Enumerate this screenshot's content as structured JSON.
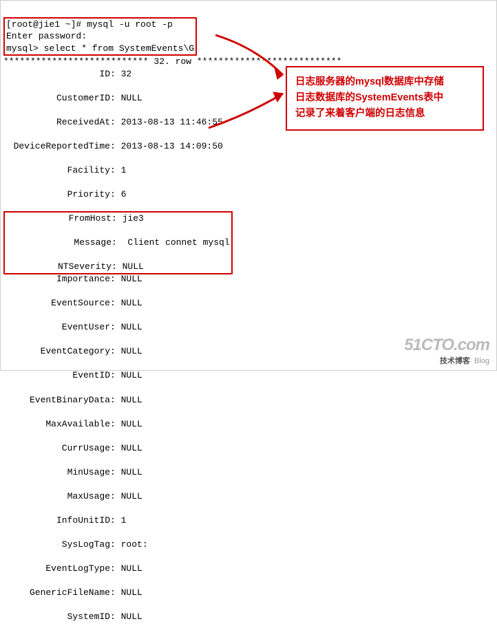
{
  "command_block": {
    "prompt": "[root@jie1 ~]# ",
    "cmd1": "mysql -u root -p",
    "pw_prompt": "Enter password:",
    "mysql_prompt": "mysql> ",
    "cmd2": "select * from SystemEvents\\G"
  },
  "separator": "*************************** 32. row ***************************",
  "rows": [
    {
      "key": "ID",
      "val": "32"
    },
    {
      "key": "CustomerID",
      "val": "NULL"
    },
    {
      "key": "ReceivedAt",
      "val": "2013-08-13 11:46:55"
    },
    {
      "key": "DeviceReportedTime",
      "val": "2013-08-13 14:09:50"
    },
    {
      "key": "Facility",
      "val": "1"
    },
    {
      "key": "Priority",
      "val": "6"
    },
    {
      "key": "FromHost",
      "val": "jie3"
    },
    {
      "key": "Message",
      "val": " Client connet mysql"
    },
    {
      "key": "NTSeverity",
      "val": "NULL"
    },
    {
      "key": "Importance",
      "val": "NULL"
    },
    {
      "key": "EventSource",
      "val": "NULL"
    },
    {
      "key": "EventUser",
      "val": "NULL"
    },
    {
      "key": "EventCategory",
      "val": "NULL"
    },
    {
      "key": "EventID",
      "val": "NULL"
    },
    {
      "key": "EventBinaryData",
      "val": "NULL"
    },
    {
      "key": "MaxAvailable",
      "val": "NULL"
    },
    {
      "key": "CurrUsage",
      "val": "NULL"
    },
    {
      "key": "MinUsage",
      "val": "NULL"
    },
    {
      "key": "MaxUsage",
      "val": "NULL"
    },
    {
      "key": "InfoUnitID",
      "val": "1"
    },
    {
      "key": "SysLogTag",
      "val": "root:"
    },
    {
      "key": "EventLogType",
      "val": "NULL"
    },
    {
      "key": "GenericFileName",
      "val": "NULL"
    },
    {
      "key": "SystemID",
      "val": "NULL"
    }
  ],
  "callout": {
    "line1": "日志服务器的mysql数据库中存储",
    "line2": "日志数据库的SystemEvents表中",
    "line3": "记录了来着客户端的日志信息"
  },
  "watermark": {
    "domain": "51CTO.com",
    "sub_zh": "技术博客",
    "sub_en": "Blog"
  }
}
